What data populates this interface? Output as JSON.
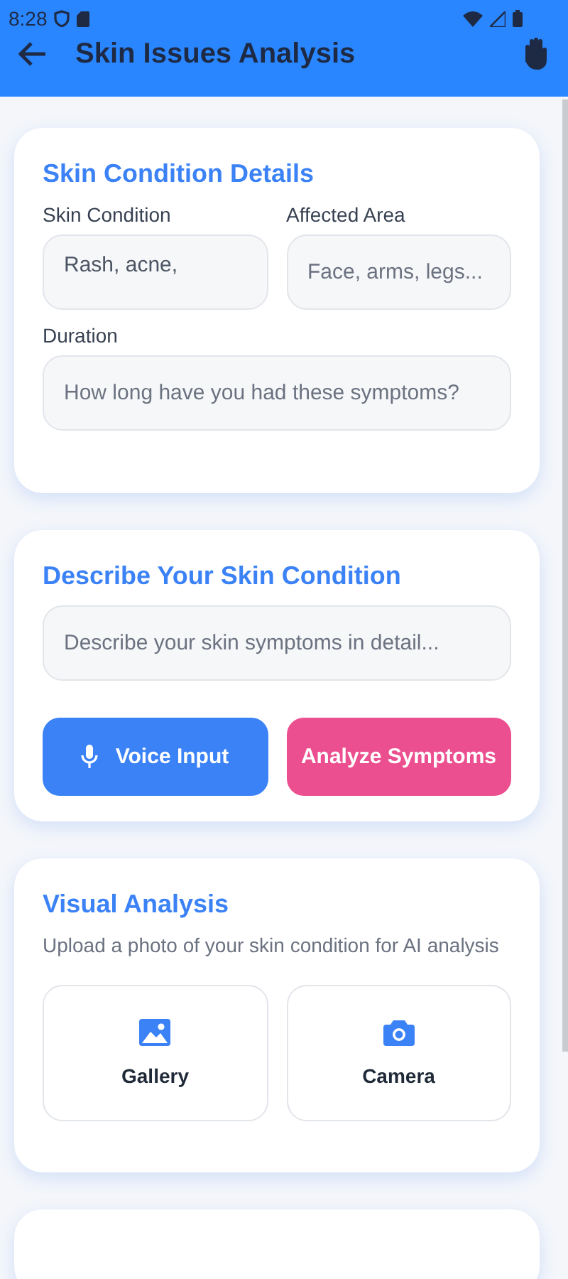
{
  "status_bar": {
    "time": "8:28"
  },
  "app_bar": {
    "title": "Skin Issues Analysis"
  },
  "details": {
    "title": "Skin Condition Details",
    "fields": [
      {
        "label": "Skin Condition",
        "value": "Rash, acne,"
      },
      {
        "label": "Affected Area",
        "placeholder": "Face, arms, legs..."
      },
      {
        "label": "Duration",
        "placeholder": "How long have you had these symptoms?"
      }
    ]
  },
  "describe": {
    "title": "Describe Your Skin Condition",
    "placeholder": "Describe your skin symptoms in detail...",
    "buttons": [
      {
        "kind": "voice",
        "label": "Voice Input"
      },
      {
        "kind": "analyze",
        "label": "Analyze Symptoms"
      }
    ]
  },
  "visual": {
    "title": "Visual Analysis",
    "subtitle": "Upload a photo of your skin condition for AI analysis",
    "options": [
      {
        "kind": "gallery",
        "label": "Gallery"
      },
      {
        "kind": "camera",
        "label": "Camera"
      }
    ]
  }
}
